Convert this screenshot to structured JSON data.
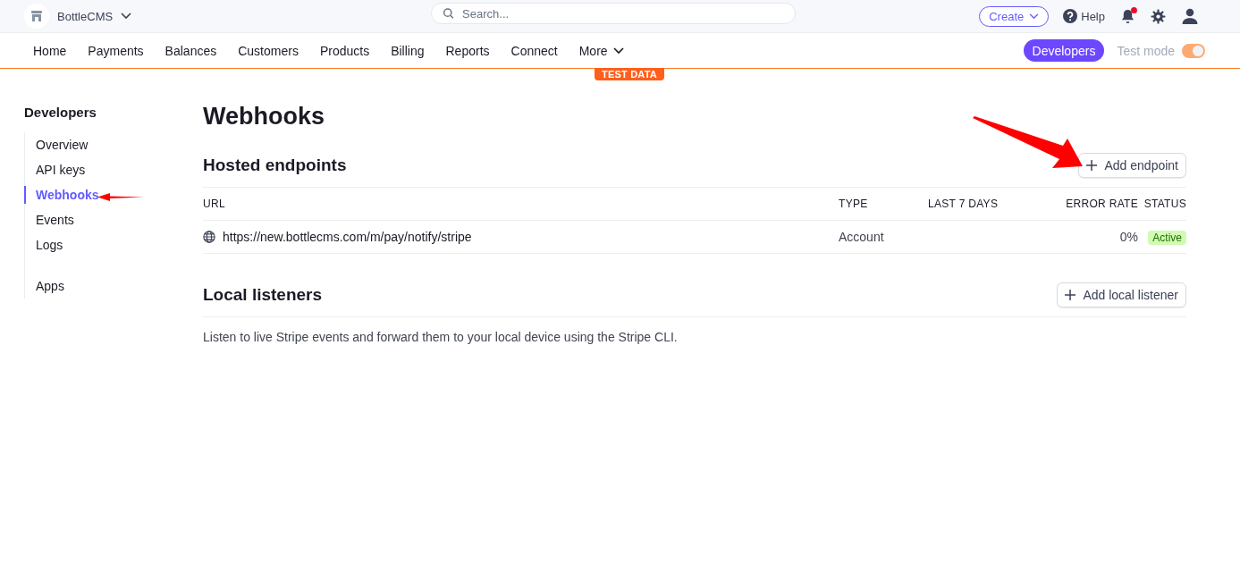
{
  "topbar": {
    "account": "BottleCMS",
    "search": {
      "placeholder": "Search..."
    },
    "create": "Create",
    "help": "Help",
    "notification_unread": true
  },
  "nav": {
    "items": [
      "Home",
      "Payments",
      "Balances",
      "Customers",
      "Products",
      "Billing",
      "Reports",
      "Connect"
    ],
    "more": "More",
    "developers": {
      "label": "Developers",
      "selected": true
    },
    "test_mode": {
      "label": "Test mode",
      "on": true
    },
    "badge": "TEST DATA"
  },
  "sidebar": {
    "title": "Developers",
    "groups": [
      [
        {
          "label": "Overview",
          "selected": false
        },
        {
          "label": "API keys",
          "selected": false
        },
        {
          "label": "Webhooks",
          "selected": true
        },
        {
          "label": "Events",
          "selected": false
        },
        {
          "label": "Logs",
          "selected": false
        }
      ],
      [
        {
          "label": "Apps",
          "selected": false
        }
      ]
    ]
  },
  "page": {
    "title": "Webhooks",
    "hosted": {
      "title": "Hosted endpoints",
      "button": "Add endpoint",
      "table": {
        "columns": [
          "URL",
          "TYPE",
          "LAST 7 DAYS",
          "ERROR RATE",
          "STATUS"
        ],
        "rows": [
          {
            "url": "https://new.bottlecms.com/m/pay/notify/stripe",
            "type": "Account",
            "error_rate": "0%",
            "status": "Active",
            "kind": "active"
          }
        ]
      }
    },
    "local": {
      "title": "Local listeners",
      "button": "Add local listener",
      "description": "Listen to live Stripe events and forward them to your local device using the Stripe CLI."
    }
  }
}
